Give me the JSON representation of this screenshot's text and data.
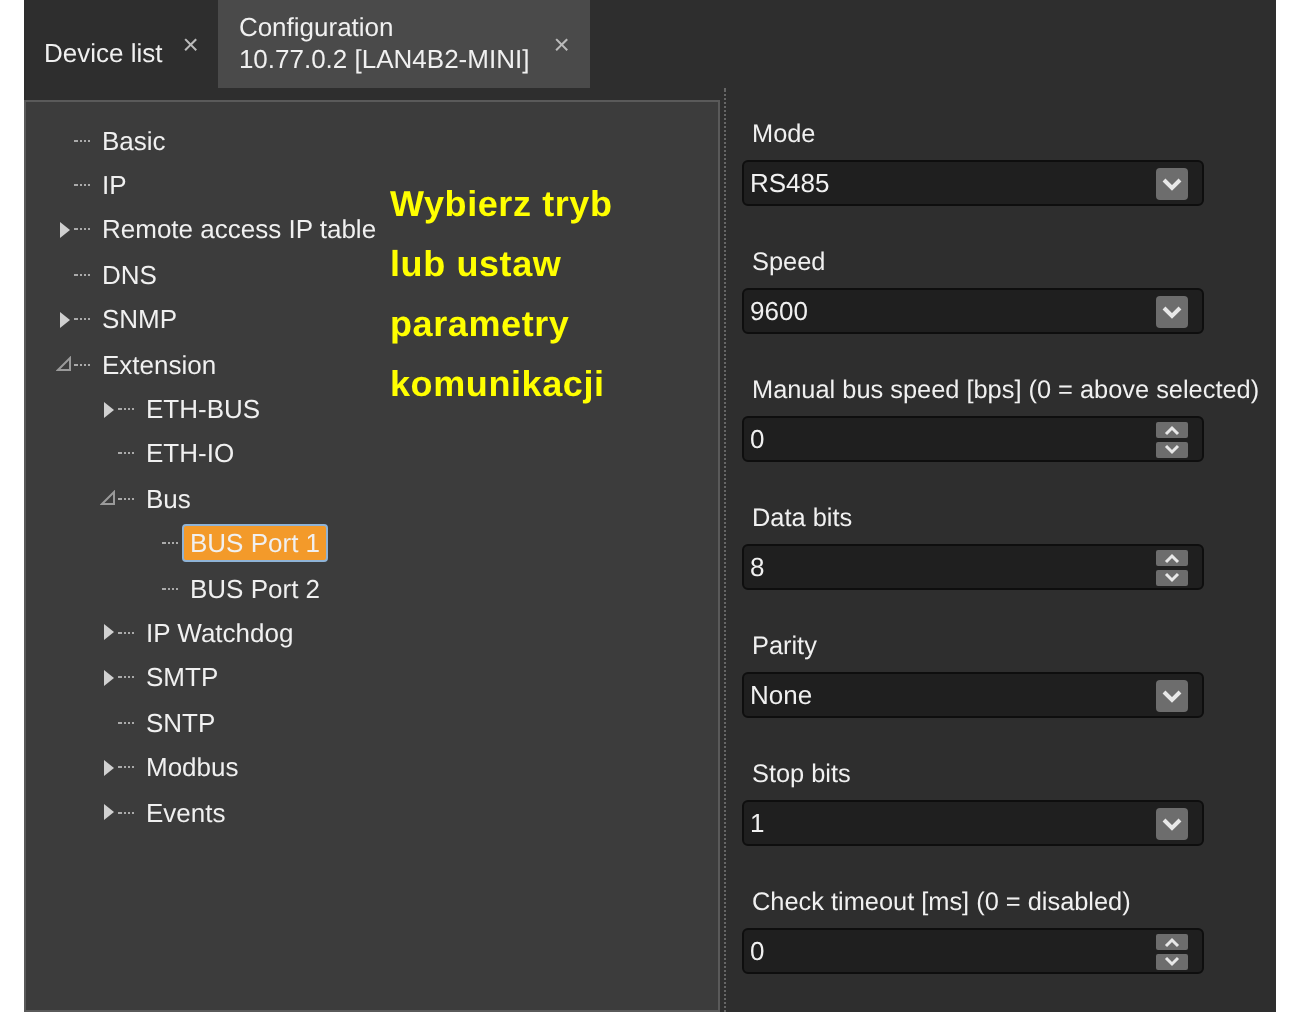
{
  "tabs": [
    {
      "lines": [
        "Device list"
      ],
      "close": "×",
      "selected": false
    },
    {
      "lines": [
        "Configuration",
        "10.77.0.2 [LAN4B2-MINI]"
      ],
      "close": "×",
      "selected": true
    }
  ],
  "tree": [
    {
      "label": "Basic",
      "selected": false
    },
    {
      "label": "IP",
      "selected": false
    },
    {
      "label": "Remote access IP table",
      "selected": false,
      "expanded": false
    },
    {
      "label": "DNS",
      "selected": false
    },
    {
      "label": "SNMP",
      "selected": false,
      "expanded": false
    },
    {
      "label": "Extension",
      "selected": false,
      "expanded": true,
      "children": [
        {
          "label": "ETH-BUS",
          "selected": false,
          "expanded": false
        },
        {
          "label": "ETH-IO",
          "selected": false
        },
        {
          "label": "Bus",
          "selected": false,
          "expanded": true,
          "children": [
            {
              "label": "BUS Port 1",
              "selected": true
            },
            {
              "label": "BUS Port 2",
              "selected": false
            }
          ]
        },
        {
          "label": "IP Watchdog",
          "selected": false,
          "expanded": false
        },
        {
          "label": "SMTP",
          "selected": false,
          "expanded": false
        },
        {
          "label": "SNTP",
          "selected": false
        },
        {
          "label": "Modbus",
          "selected": false,
          "expanded": false
        },
        {
          "label": "Events",
          "selected": false,
          "expanded": false
        }
      ]
    }
  ],
  "annotation": [
    "Wybierz tryb",
    "lub ustaw",
    "parametry",
    "komunikacji"
  ],
  "fields": [
    {
      "label": "Mode",
      "kind": "select",
      "value": "RS485"
    },
    {
      "label": "Speed",
      "kind": "select",
      "value": "9600"
    },
    {
      "label": "Manual bus speed [bps] (0 = above selected)",
      "kind": "spin",
      "value": "0"
    },
    {
      "label": "Data bits",
      "kind": "spin",
      "value": "8"
    },
    {
      "label": "Parity",
      "kind": "select",
      "value": "None"
    },
    {
      "label": "Stop bits",
      "kind": "select",
      "value": "1"
    },
    {
      "label": "Check timeout [ms] (0 = disabled)",
      "kind": "spin",
      "value": "0"
    }
  ]
}
